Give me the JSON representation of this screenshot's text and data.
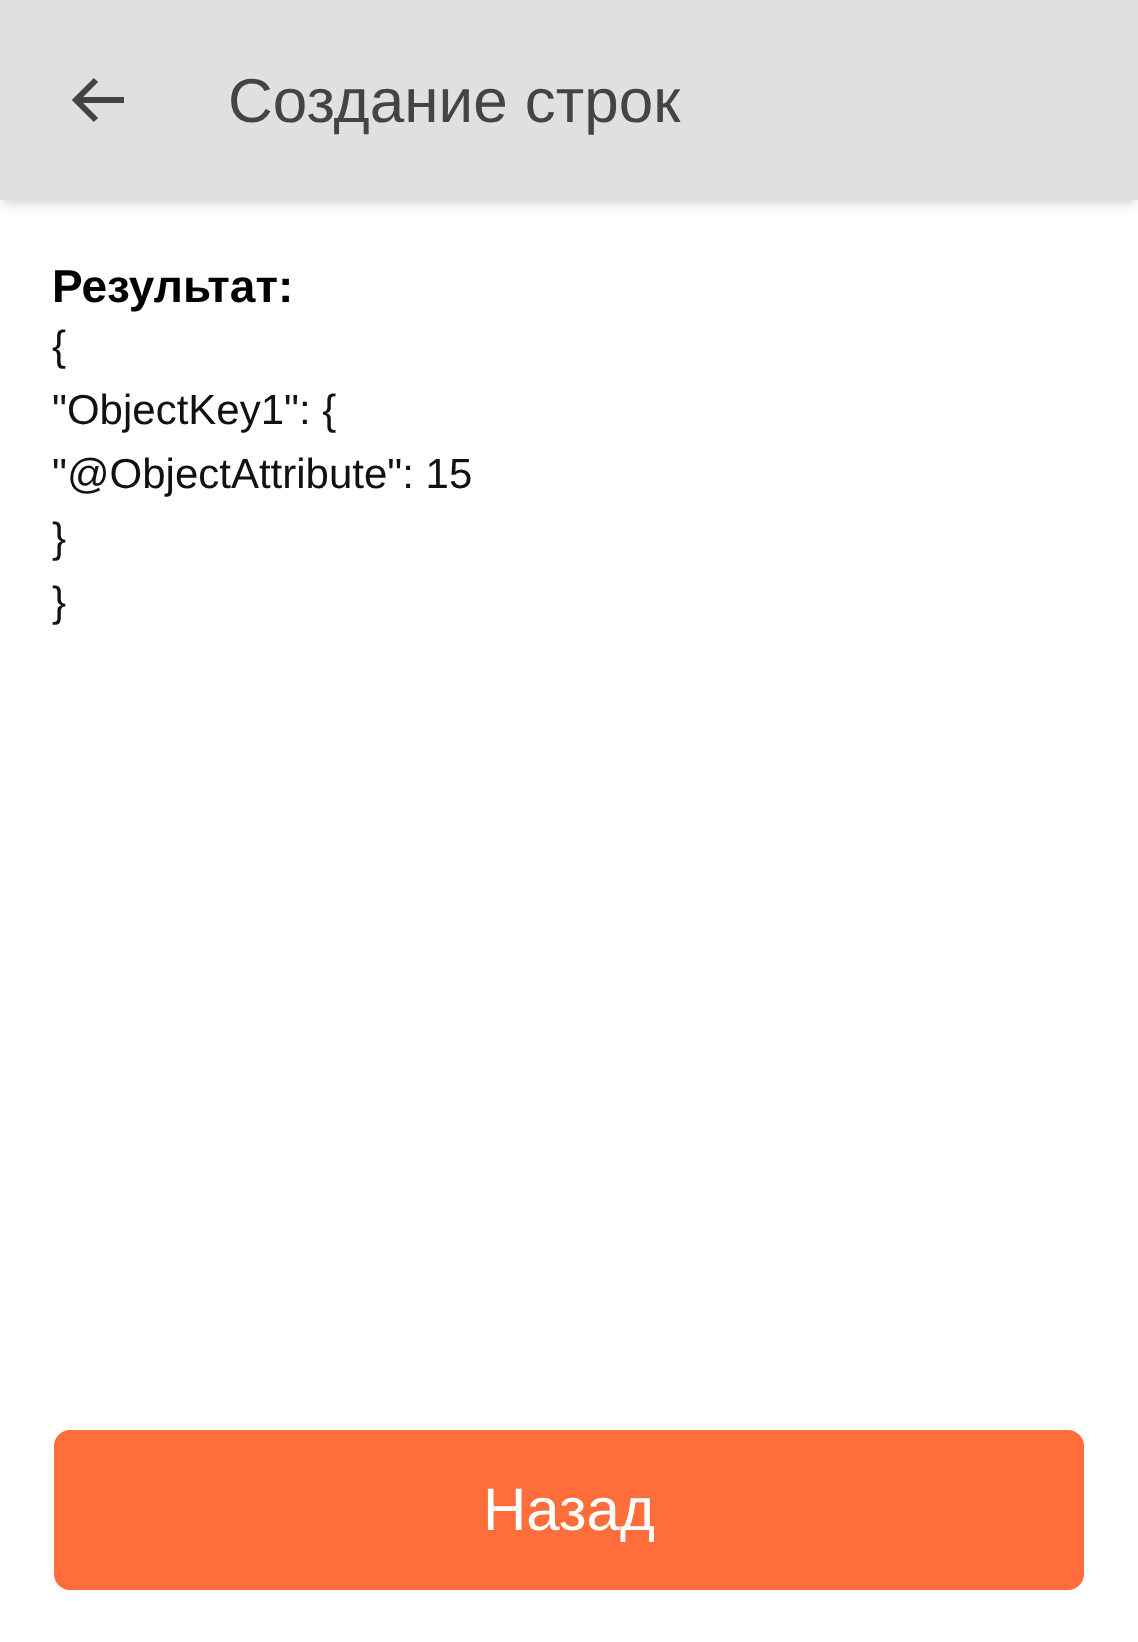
{
  "header": {
    "title": "Создание строк"
  },
  "result": {
    "label": "Результат:",
    "lines": [
      "{",
      "\"ObjectKey1\": {",
      "\"@ObjectAttribute\": 15",
      "}",
      "}"
    ]
  },
  "buttons": [
    {
      "label": "Назад"
    }
  ]
}
